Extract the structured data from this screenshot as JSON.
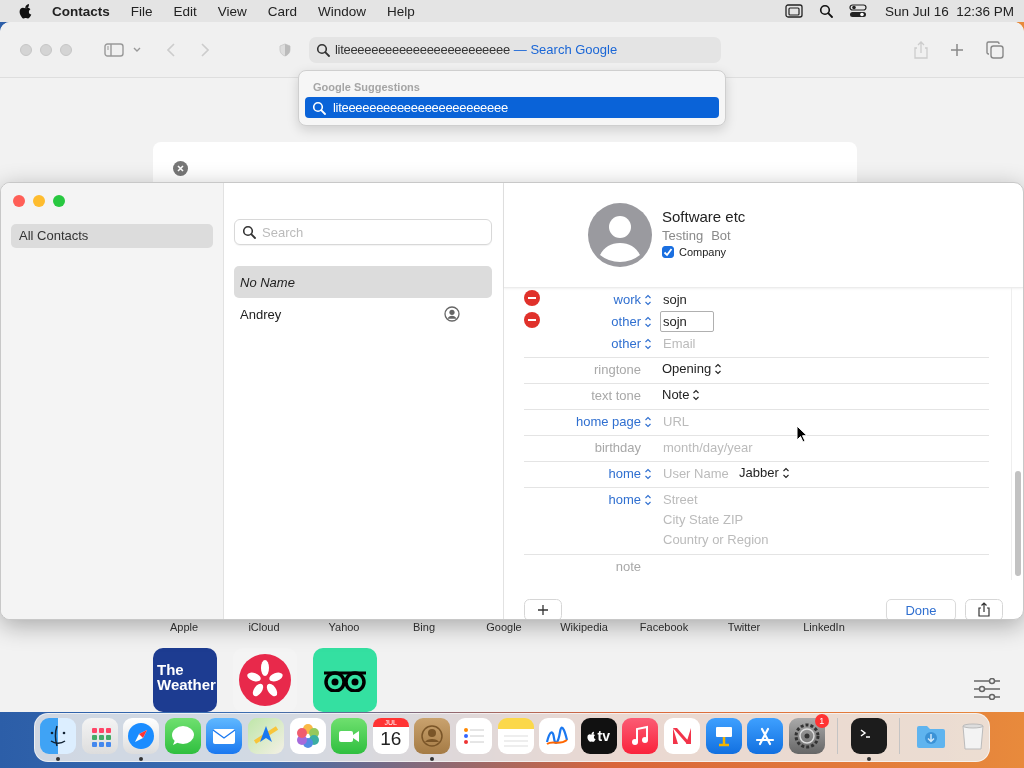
{
  "menu_bar": {
    "app_name": "Contacts",
    "menus": [
      "File",
      "Edit",
      "View",
      "Card",
      "Window",
      "Help"
    ],
    "clock": "Sun Jul 16  12:36 PM"
  },
  "browser": {
    "address": {
      "value": "liteeeeeeeeeeeeeeeeeeeeeeee",
      "suffix": "— Search Google"
    },
    "suggestions": {
      "heading": "Google Suggestions",
      "items": [
        {
          "text": "liteeeeeeeeeeeeeeeeeeeeeeee",
          "selected": true
        }
      ]
    },
    "favorites": [
      "Apple",
      "iCloud",
      "Yahoo",
      "Bing",
      "Google",
      "Wikipedia",
      "Facebook",
      "Twitter",
      "LinkedIn"
    ],
    "tiles": [
      {
        "kind": "weather",
        "text": "The Weather"
      },
      {
        "kind": "yelp"
      },
      {
        "kind": "owl"
      }
    ]
  },
  "contacts": {
    "sidebar": {
      "items": [
        {
          "label": "All Contacts",
          "selected": true
        }
      ]
    },
    "search": {
      "placeholder": "Search"
    },
    "list": [
      {
        "name": "No Name",
        "selected": true,
        "kind": "unnamed"
      },
      {
        "name": "Andrey",
        "selected": false,
        "kind": "me"
      }
    ],
    "card": {
      "company_name": "Software etc",
      "first_name": "Testing",
      "last_name": "Bot",
      "company": {
        "label": "Company",
        "checked": true
      },
      "fields": [
        {
          "label": "work",
          "label_popup": true,
          "removable": true,
          "divider": false,
          "parts": [
            {
              "kind": "field",
              "value": "sojn",
              "focused": false
            }
          ]
        },
        {
          "label": "other",
          "label_popup": true,
          "removable": true,
          "divider": false,
          "parts": [
            {
              "kind": "field",
              "value": "sojn",
              "focused": true
            }
          ]
        },
        {
          "label": "other",
          "label_popup": true,
          "removable": false,
          "divider": true,
          "parts": [
            {
              "kind": "field",
              "placeholder": "Email"
            }
          ]
        },
        {
          "label": "ringtone",
          "label_popup": false,
          "removable": false,
          "divider": true,
          "parts": [
            {
              "kind": "popup",
              "text": "Opening"
            }
          ]
        },
        {
          "label": "text tone",
          "label_popup": false,
          "removable": false,
          "divider": true,
          "parts": [
            {
              "kind": "popup",
              "text": "Note"
            }
          ]
        },
        {
          "label": "home page",
          "label_popup": true,
          "removable": false,
          "divider": true,
          "parts": [
            {
              "kind": "field",
              "placeholder": "URL"
            }
          ]
        },
        {
          "label": "birthday",
          "label_popup": false,
          "removable": false,
          "divider": true,
          "parts": [
            {
              "kind": "field",
              "placeholder": "month/day/year"
            }
          ]
        },
        {
          "label": "home",
          "label_popup": true,
          "removable": false,
          "divider": true,
          "parts": [
            {
              "kind": "field",
              "placeholder": "User Name"
            },
            {
              "kind": "popup",
              "text": "Jabber"
            }
          ]
        },
        {
          "label": "home",
          "label_popup": true,
          "removable": false,
          "divider": true,
          "parts": [
            {
              "kind": "address",
              "lines": [
                {
                  "placeholder": "Street"
                },
                {
                  "placeholder": "City State ZIP"
                },
                {
                  "placeholder": "Country or Region"
                }
              ]
            }
          ]
        },
        {
          "label": "note",
          "label_popup": false,
          "removable": false,
          "divider": false
        }
      ]
    },
    "done_button": "Done"
  },
  "dock": [
    {
      "kind": "finder",
      "running": true
    },
    {
      "kind": "launchpad",
      "running": false
    },
    {
      "kind": "safari",
      "running": true
    },
    {
      "kind": "messages",
      "running": false
    },
    {
      "kind": "mail",
      "running": false
    },
    {
      "kind": "maps",
      "running": false
    },
    {
      "kind": "photos",
      "running": false
    },
    {
      "kind": "facetime",
      "running": false
    },
    {
      "kind": "calendar",
      "running": false,
      "month": "JUL",
      "day": "16"
    },
    {
      "kind": "contacts",
      "running": true
    },
    {
      "kind": "reminders",
      "running": false
    },
    {
      "kind": "notes",
      "running": false
    },
    {
      "kind": "freeform",
      "running": false
    },
    {
      "kind": "tv",
      "running": false,
      "text": "tv"
    },
    {
      "kind": "music",
      "running": false
    },
    {
      "kind": "news",
      "running": false
    },
    {
      "kind": "keynote",
      "running": false
    },
    {
      "kind": "appstore",
      "running": false
    },
    {
      "kind": "settings",
      "running": false,
      "badge": "1"
    },
    {
      "kind": "separator"
    },
    {
      "kind": "terminal",
      "running": true
    },
    {
      "kind": "separator"
    },
    {
      "kind": "downloads",
      "running": false
    },
    {
      "kind": "trash",
      "running": false
    }
  ]
}
